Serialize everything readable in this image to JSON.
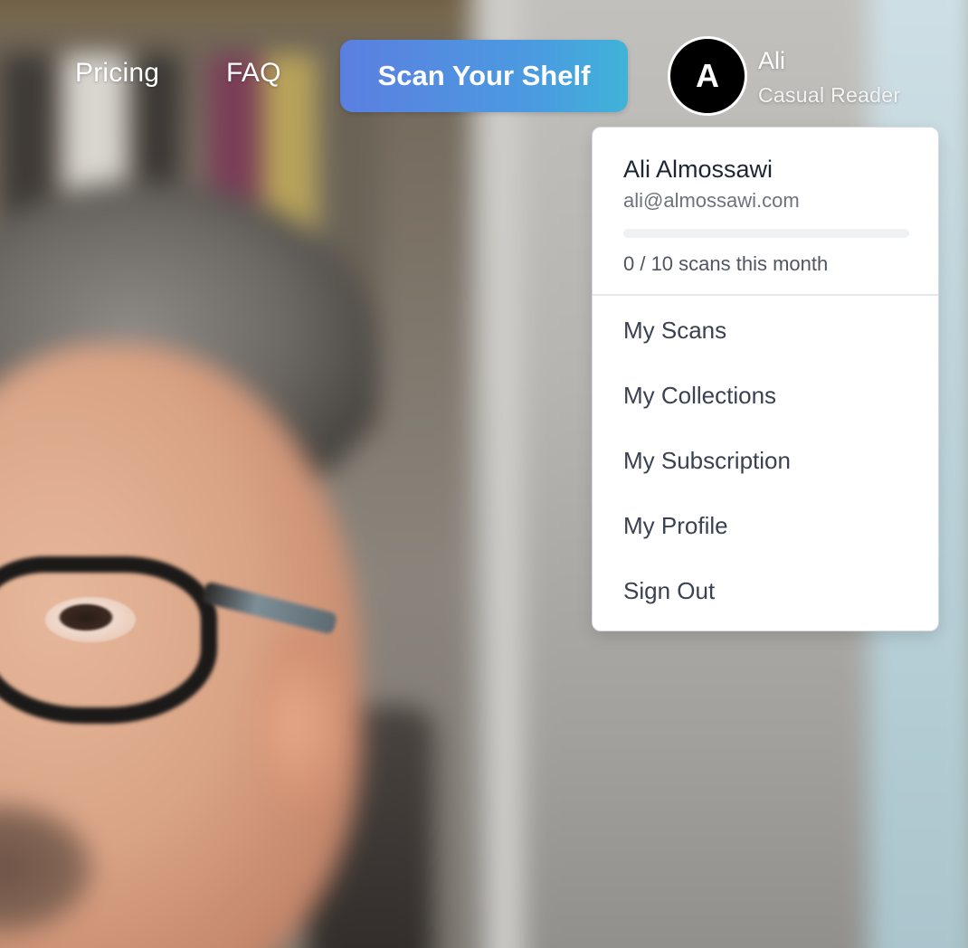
{
  "nav": {
    "pricing_label": "Pricing",
    "faq_label": "FAQ",
    "scan_button_label": "Scan Your Shelf"
  },
  "user": {
    "avatar_initial": "A",
    "name": "Ali",
    "role": "Casual Reader"
  },
  "dropdown": {
    "full_name": "Ali Almossawi",
    "email": "ali@almossawi.com",
    "scans_used": 0,
    "scans_limit": 10,
    "usage_text": "0 / 10 scans this month",
    "progress_fraction": 0,
    "items": [
      {
        "label": "My Scans"
      },
      {
        "label": "My Collections"
      },
      {
        "label": "My Subscription"
      },
      {
        "label": "My Profile"
      },
      {
        "label": "Sign Out"
      }
    ]
  },
  "colors": {
    "scan_button_gradient_start": "#5b7fe0",
    "scan_button_gradient_end": "#3fb3d8",
    "avatar_bg": "#000000",
    "menu_text": "#3a4150"
  }
}
